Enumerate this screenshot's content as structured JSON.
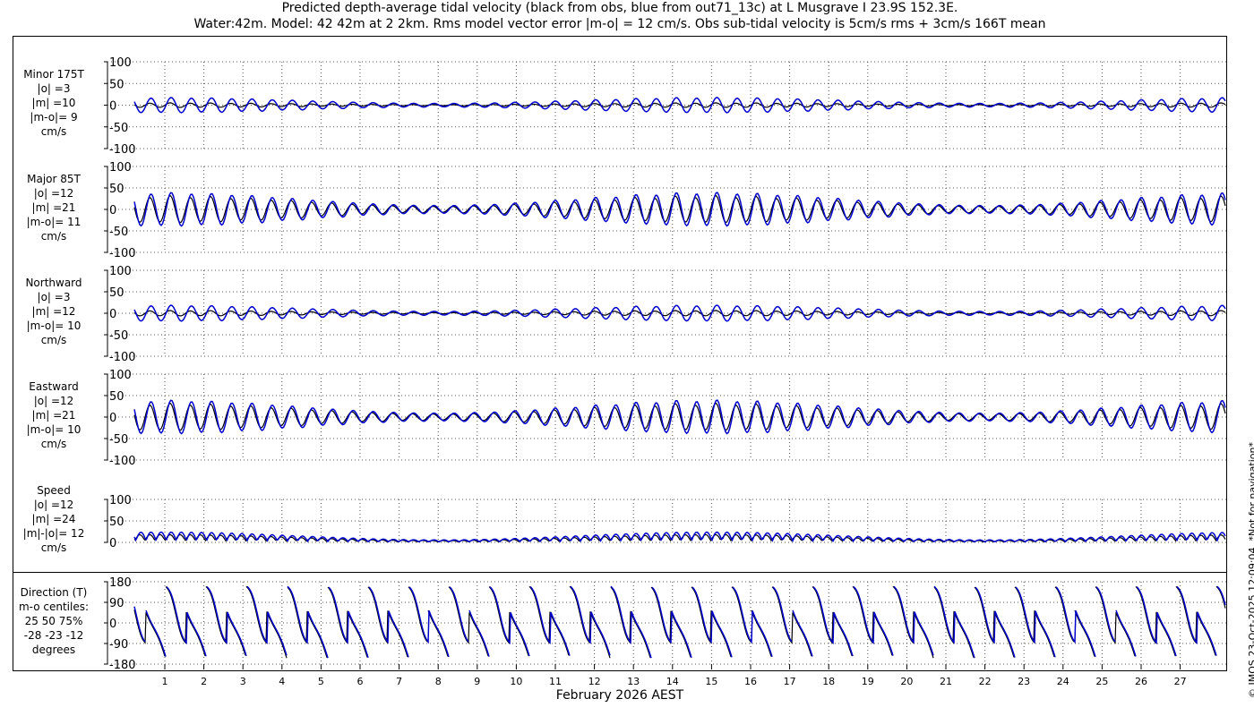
{
  "title_line1": "Predicted depth-average tidal velocity (black from obs, blue from out71_13c) at L Musgrave I 23.9S 152.3E.",
  "title_line2": "Water:42m. Model: 42 42m at 2 2km. Rms model vector error |m-o| = 12 cm/s. Obs sub-tidal velocity is 5cm/s rms + 3cm/s 166T mean",
  "xlabel": "February 2026 AEST",
  "copyright": "© IMOS 23-Oct-2025 12:09:04. *Not for navigation*",
  "colors": {
    "obs": "#000000",
    "model": "#0000cc",
    "grid": "#555555"
  },
  "chart_data": {
    "type": "line",
    "x_ticks": [
      "1",
      "2",
      "3",
      "4",
      "5",
      "6",
      "7",
      "8",
      "9",
      "10",
      "11",
      "12",
      "13",
      "14",
      "15",
      "16",
      "17",
      "18",
      "19",
      "20",
      "21",
      "22",
      "23",
      "24",
      "25",
      "26",
      "27"
    ],
    "xlim_days": [
      0,
      27.8
    ],
    "series_names": [
      "obs",
      "model"
    ],
    "panels": [
      {
        "id": "minor",
        "labels": [
          "Minor 175T",
          "|o| =3",
          "|m| =10",
          "|m-o|= 9",
          "cm/s"
        ],
        "ylim": [
          -100,
          100
        ],
        "yticks": [
          "100",
          "50",
          "0",
          "-50",
          "-100"
        ],
        "amp_obs": 5,
        "amp_model": 17,
        "offset": 0
      },
      {
        "id": "major",
        "labels": [
          "Major 85T",
          "|o| =12",
          "|m| =21",
          "|m-o|= 11",
          "cm/s"
        ],
        "ylim": [
          -100,
          100
        ],
        "yticks": [
          "100",
          "50",
          "0",
          "-50",
          "-100"
        ],
        "amp_obs": 30,
        "amp_model": 38,
        "offset": 0
      },
      {
        "id": "northward",
        "labels": [
          "Northward",
          "|o| =3",
          "|m| =12",
          "|m-o|= 10",
          "cm/s"
        ],
        "ylim": [
          -100,
          100
        ],
        "yticks": [
          "100",
          "50",
          "0",
          "-50",
          "-100"
        ],
        "amp_obs": 6,
        "amp_model": 18,
        "offset": 0
      },
      {
        "id": "eastward",
        "labels": [
          "Eastward",
          "|o| =12",
          "|m| =21",
          "|m-o|= 10",
          "cm/s"
        ],
        "ylim": [
          -100,
          100
        ],
        "yticks": [
          "100",
          "50",
          "0",
          "-50",
          "-100"
        ],
        "amp_obs": 30,
        "amp_model": 38,
        "offset": 0
      },
      {
        "id": "speed",
        "labels": [
          "Speed",
          "|o| =12",
          "|m| =24",
          "|m|-|o|= 12",
          "cm/s"
        ],
        "ylim": [
          0,
          100
        ],
        "yticks": [
          "100",
          "50",
          "0"
        ],
        "amp_obs": 14,
        "amp_model": 20,
        "offset": 0
      },
      {
        "id": "direction",
        "labels": [
          "Direction (T)",
          "m-o centiles:",
          "25  50  75%",
          "-28 -23 -12",
          "degrees"
        ],
        "ylim": [
          -180,
          180
        ],
        "yticks": [
          "180",
          "90",
          "0",
          "-90",
          "-180"
        ],
        "amp_obs": 0,
        "amp_model": 0,
        "offset": 0
      }
    ]
  }
}
